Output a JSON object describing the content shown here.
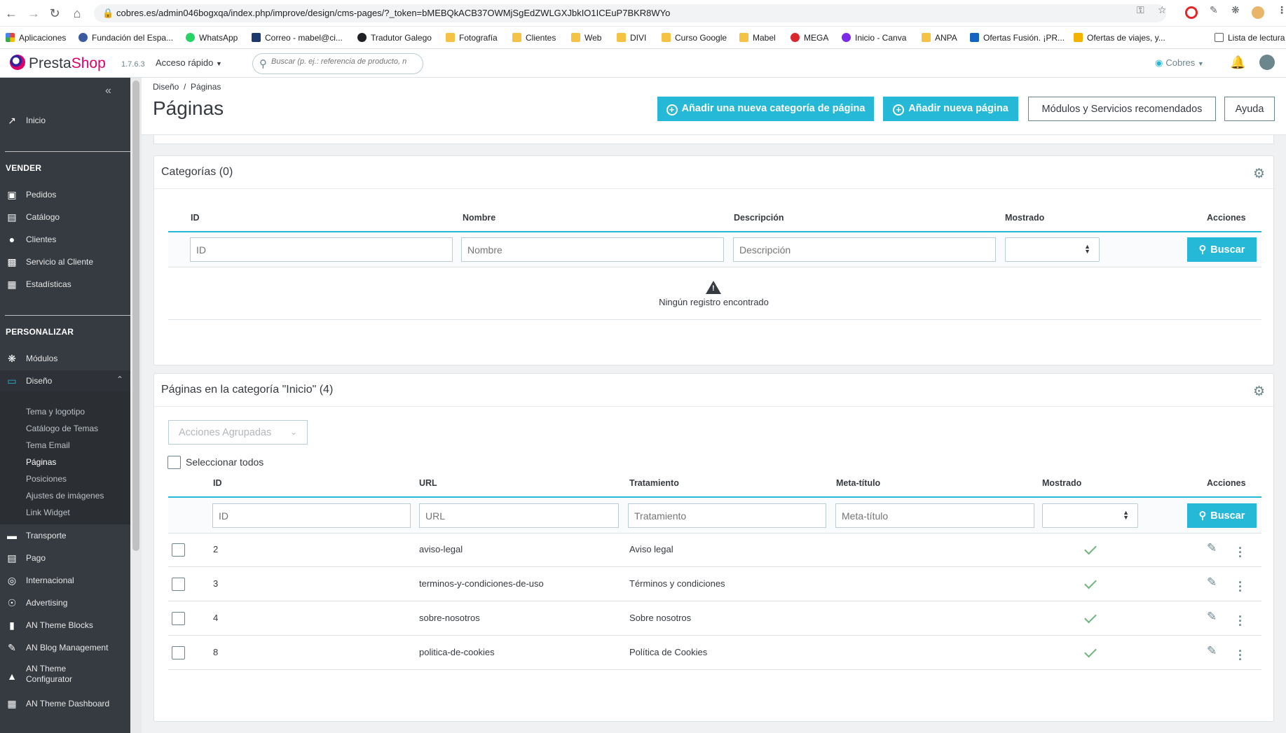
{
  "browser": {
    "url": "cobres.es/admin046bogxqa/index.php/improve/design/cms-pages/?_token=bMEBQkACB37OWMjSgEdZWLGXJbkIO1ICEuP7BKR8WYo",
    "bookmarks": [
      "Aplicaciones",
      "Fundación del Espa...",
      "WhatsApp",
      "Correo - mabel@ci...",
      "Tradutor Galego",
      "Fotografía",
      "Clientes",
      "Web",
      "DIVI",
      "Curso Google",
      "Mabel",
      "MEGA",
      "Inicio - Canva",
      "ANPA",
      "Ofertas Fusión. ¡PR...",
      "Ofertas de viajes, y...",
      "Lista de lectura"
    ]
  },
  "header": {
    "logo_presta": "Presta",
    "logo_shop": "Shop",
    "version": "1.7.6.3",
    "quick_access": "Acceso rápido",
    "search_placeholder": "Buscar (p. ej.: referencia de producto, n",
    "shop_name": "Cobres"
  },
  "sidebar": {
    "home": "Inicio",
    "section_sell": "VENDER",
    "sell_items": [
      "Pedidos",
      "Catálogo",
      "Clientes",
      "Servicio al Cliente",
      "Estadísticas"
    ],
    "section_customize": "PERSONALIZAR",
    "modules": "Módulos",
    "design": "Diseño",
    "design_sub": [
      "Tema y logotipo",
      "Catálogo de Temas",
      "Tema Email",
      "Páginas",
      "Posiciones",
      "Ajustes de imágenes",
      "Link Widget"
    ],
    "other_items": [
      "Transporte",
      "Pago",
      "Internacional",
      "Advertising",
      "AN Theme Blocks",
      "AN Blog Management",
      "AN Theme Configurator",
      "AN Theme Dashboard"
    ]
  },
  "toolbar": {
    "breadcrumb_parent": "Diseño",
    "breadcrumb_current": "Páginas",
    "title": "Páginas",
    "btn_add_category": "Añadir una nueva categoría de página",
    "btn_add_page": "Añadir nueva página",
    "btn_modules": "Módulos y Servicios recomendados",
    "btn_help": "Ayuda"
  },
  "categories_panel": {
    "title": "Categorías (0)",
    "columns": [
      "ID",
      "Nombre",
      "Descripción",
      "Mostrado",
      "Acciones"
    ],
    "filter_placeholders": [
      "ID",
      "Nombre",
      "Descripción"
    ],
    "search_button": "Buscar",
    "empty_message": "Ningún registro encontrado"
  },
  "pages_panel": {
    "title": "Páginas en la categoría \"Inicio\" (4)",
    "bulk_actions": "Acciones Agrupadas",
    "select_all": "Seleccionar todos",
    "columns": [
      "ID",
      "URL",
      "Tratamiento",
      "Meta-título",
      "Mostrado",
      "Acciones"
    ],
    "filter_placeholders": [
      "ID",
      "URL",
      "Tratamiento",
      "Meta-título"
    ],
    "search_button": "Buscar",
    "rows": [
      {
        "id": "2",
        "url": "aviso-legal",
        "title": "Aviso legal",
        "meta": "",
        "shown": true
      },
      {
        "id": "3",
        "url": "terminos-y-condiciones-de-uso",
        "title": "Términos y condiciones",
        "meta": "",
        "shown": true
      },
      {
        "id": "4",
        "url": "sobre-nosotros",
        "title": "Sobre nosotros",
        "meta": "",
        "shown": true
      },
      {
        "id": "8",
        "url": "politica-de-cookies",
        "title": "Política de Cookies",
        "meta": "",
        "shown": true
      }
    ]
  },
  "colors": {
    "accent": "#25b9d7",
    "sidebar": "#363a41",
    "success": "#70b580",
    "brand": "#df0067"
  }
}
